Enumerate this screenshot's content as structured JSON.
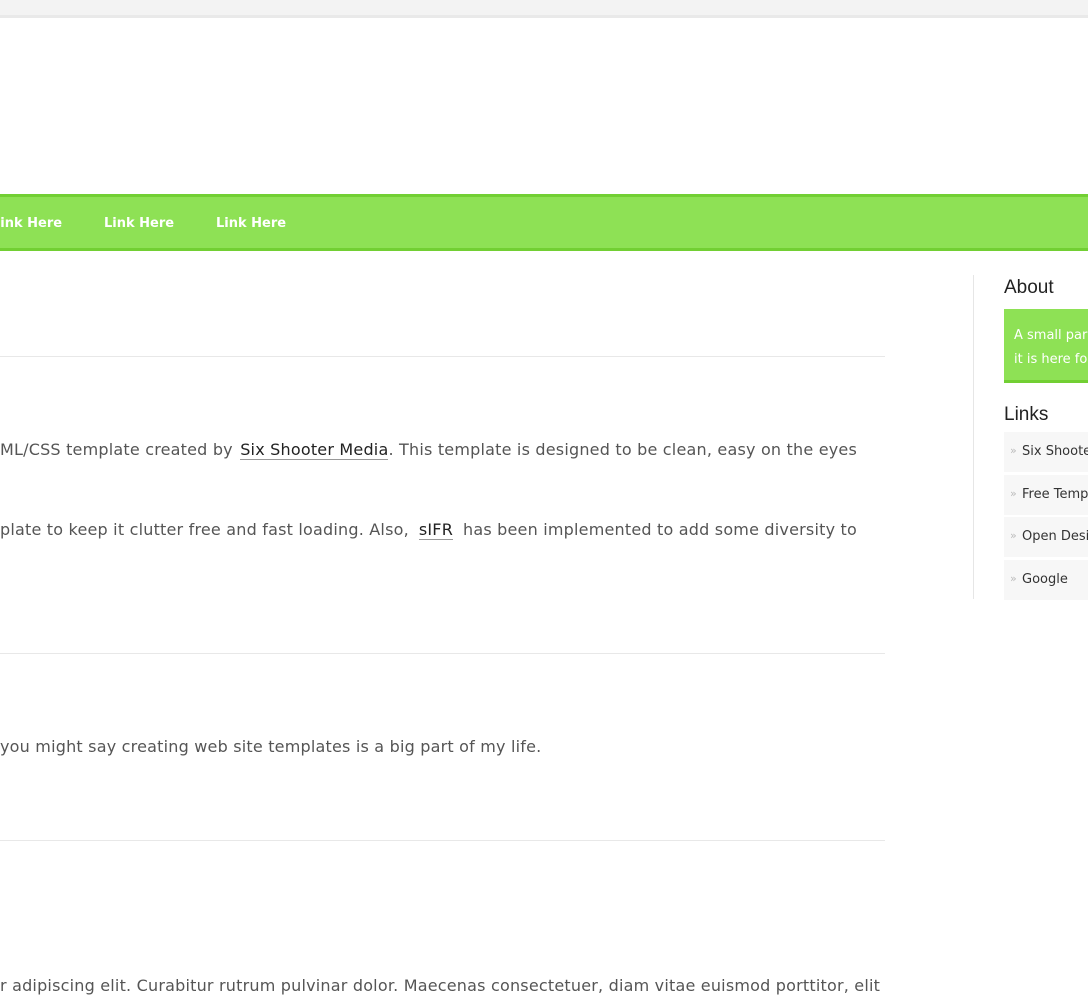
{
  "nav": {
    "links": [
      "Link Here",
      "Link Here",
      "Link Here"
    ]
  },
  "content": {
    "p1": {
      "text_a": "ML/CSS template created by",
      "link": "Six Shooter Media",
      "text_b": ". This template is designed to be clean, easy on the eyes"
    },
    "p2": {
      "text_a": "plate to keep it clutter free and fast loading. Also,",
      "link": "sIFR",
      "text_b": "has been implemented to add some diversity to"
    },
    "p3": "you might say creating web site templates is a big part of my life.",
    "p4": "r adipiscing elit. Curabitur rutrum pulvinar dolor. Maecenas consectetuer, diam vitae euismod porttitor, elit"
  },
  "sidebar": {
    "about_heading": "About",
    "about_text_line1": "A small para",
    "about_text_line2": "it is here fo",
    "links_heading": "Links",
    "links": [
      "Six Shooter",
      "Free Temp",
      "Open Desi",
      "Google"
    ],
    "bullet": "»"
  },
  "colors": {
    "accent": "#8ee155",
    "accent_border": "#72cf33"
  }
}
